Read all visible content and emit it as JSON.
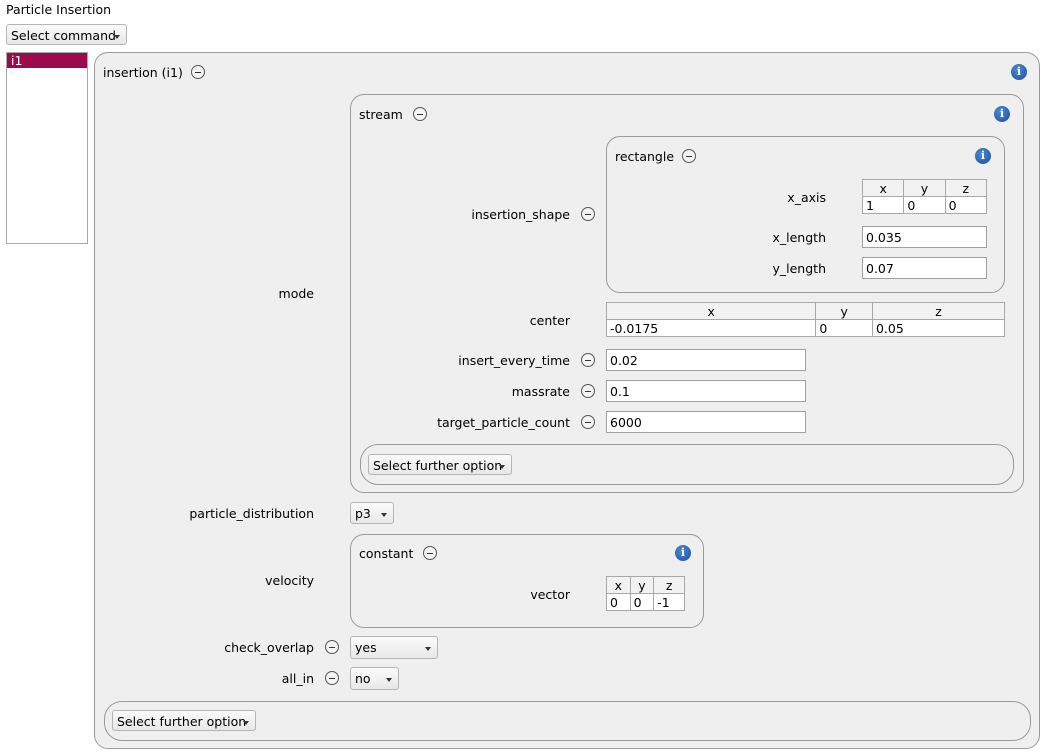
{
  "page": {
    "title": "Particle Insertion"
  },
  "toolbar": {
    "select_command": "Select command"
  },
  "list": {
    "items": [
      "i1"
    ]
  },
  "insertion": {
    "title": "insertion (i1)",
    "mode_label": "mode",
    "stream": {
      "title": "stream",
      "insertion_shape_label": "insertion_shape",
      "rectangle": {
        "title": "rectangle",
        "x_axis_label": "x_axis",
        "x_axis": {
          "headers": [
            "x",
            "y",
            "z"
          ],
          "values": [
            "1",
            "0",
            "0"
          ]
        },
        "x_length_label": "x_length",
        "x_length": "0.035",
        "y_length_label": "y_length",
        "y_length": "0.07"
      },
      "center_label": "center",
      "center": {
        "headers": [
          "x",
          "y",
          "z"
        ],
        "values": [
          "-0.0175",
          "0",
          "0.05"
        ]
      },
      "insert_every_time_label": "insert_every_time",
      "insert_every_time": "0.02",
      "massrate_label": "massrate",
      "massrate": "0.1",
      "target_particle_count_label": "target_particle_count",
      "target_particle_count": "6000",
      "further_option": "Select further option"
    },
    "particle_distribution_label": "particle_distribution",
    "particle_distribution": "p3",
    "velocity_label": "velocity",
    "velocity": {
      "title": "constant",
      "vector_label": "vector",
      "vector": {
        "headers": [
          "x",
          "y",
          "z"
        ],
        "values": [
          "0",
          "0",
          "-1"
        ]
      }
    },
    "check_overlap_label": "check_overlap",
    "check_overlap": "yes",
    "all_in_label": "all_in",
    "all_in": "no",
    "further_option": "Select further option"
  },
  "colors": {
    "selection": "#9c0a4c",
    "info": "#1f5fae",
    "panel": "#efefef"
  }
}
